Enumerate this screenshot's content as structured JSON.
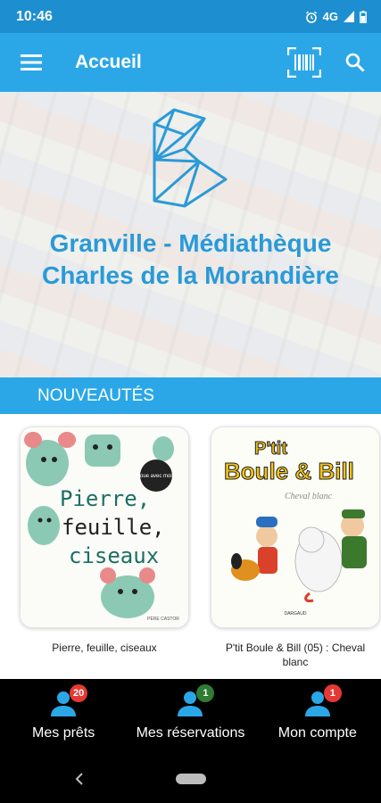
{
  "status_bar": {
    "time": "10:46",
    "network": "4G"
  },
  "app_bar": {
    "title": "Accueil",
    "menu_icon": "menu-icon",
    "barcode_icon": "barcode-scan-icon",
    "search_icon": "search-icon"
  },
  "hero": {
    "title_line1": "Granville - Médiathèque",
    "title_line2": "Charles de la Morandière",
    "logo_color": "#2a9ad8"
  },
  "section": {
    "title": "NOUVEAUTÉS"
  },
  "books": [
    {
      "title": "Pierre, feuille, ciseaux",
      "cover_text_1": "Pierre,",
      "cover_text_2": "feuille,",
      "cover_text_3": "ciseaux",
      "cover_badge": "Joue avec moi !",
      "cover_publisher": "PÈRE CASTOR"
    },
    {
      "title": "P'tit Boule & Bill (05) : Cheval blanc",
      "cover_text_1": "P'tit",
      "cover_text_2": "Boule & Bill",
      "cover_subtitle": "Cheval blanc",
      "cover_publisher": "DARGAUD"
    }
  ],
  "bottom_nav": [
    {
      "label": "Mes prêts",
      "badge": "20",
      "badge_color": "#e53935"
    },
    {
      "label": "Mes réservations",
      "badge": "1",
      "badge_color": "#2e7d32"
    },
    {
      "label": "Mon compte",
      "badge": "1",
      "badge_color": "#e53935"
    }
  ],
  "colors": {
    "accent": "#2ba7e8",
    "status": "#1d8fd0",
    "nav_bg": "#000000"
  }
}
